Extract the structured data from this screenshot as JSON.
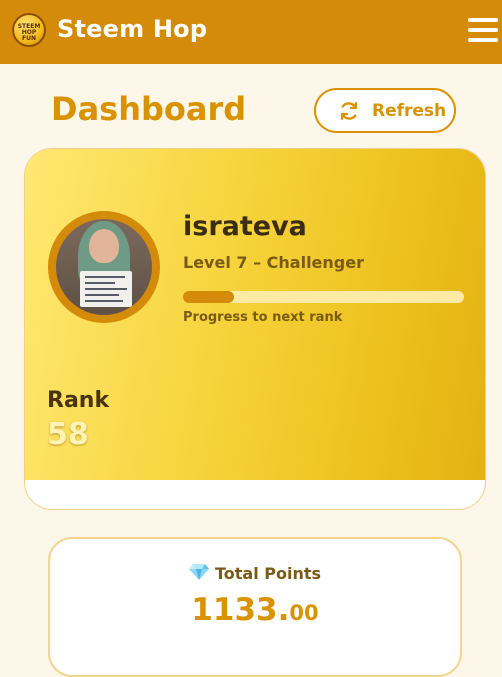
{
  "app": {
    "title": "Steem Hop",
    "logo_text": [
      "STEEM",
      "HOP",
      "FUN"
    ]
  },
  "header": {
    "page_title": "Dashboard",
    "refresh_label": "Refresh"
  },
  "profile": {
    "username": "israteva",
    "level_text": "Level 7 – Challenger",
    "progress_fraction": 0.18,
    "progress_caption": "Progress to next rank",
    "rank_label": "Rank",
    "rank_value": "58"
  },
  "points": {
    "label": "Total Points",
    "integer_part": "1133.",
    "decimal_part": "00"
  },
  "colors": {
    "accent": "#d48b0a",
    "title_gold": "#d99200",
    "card_gradient_start": "#ffe873",
    "card_gradient_end": "#e3b113",
    "background": "#fdf7e9"
  },
  "icons": {
    "menu": "hamburger-menu-icon",
    "refresh": "refresh-icon",
    "gem": "gem-icon"
  }
}
